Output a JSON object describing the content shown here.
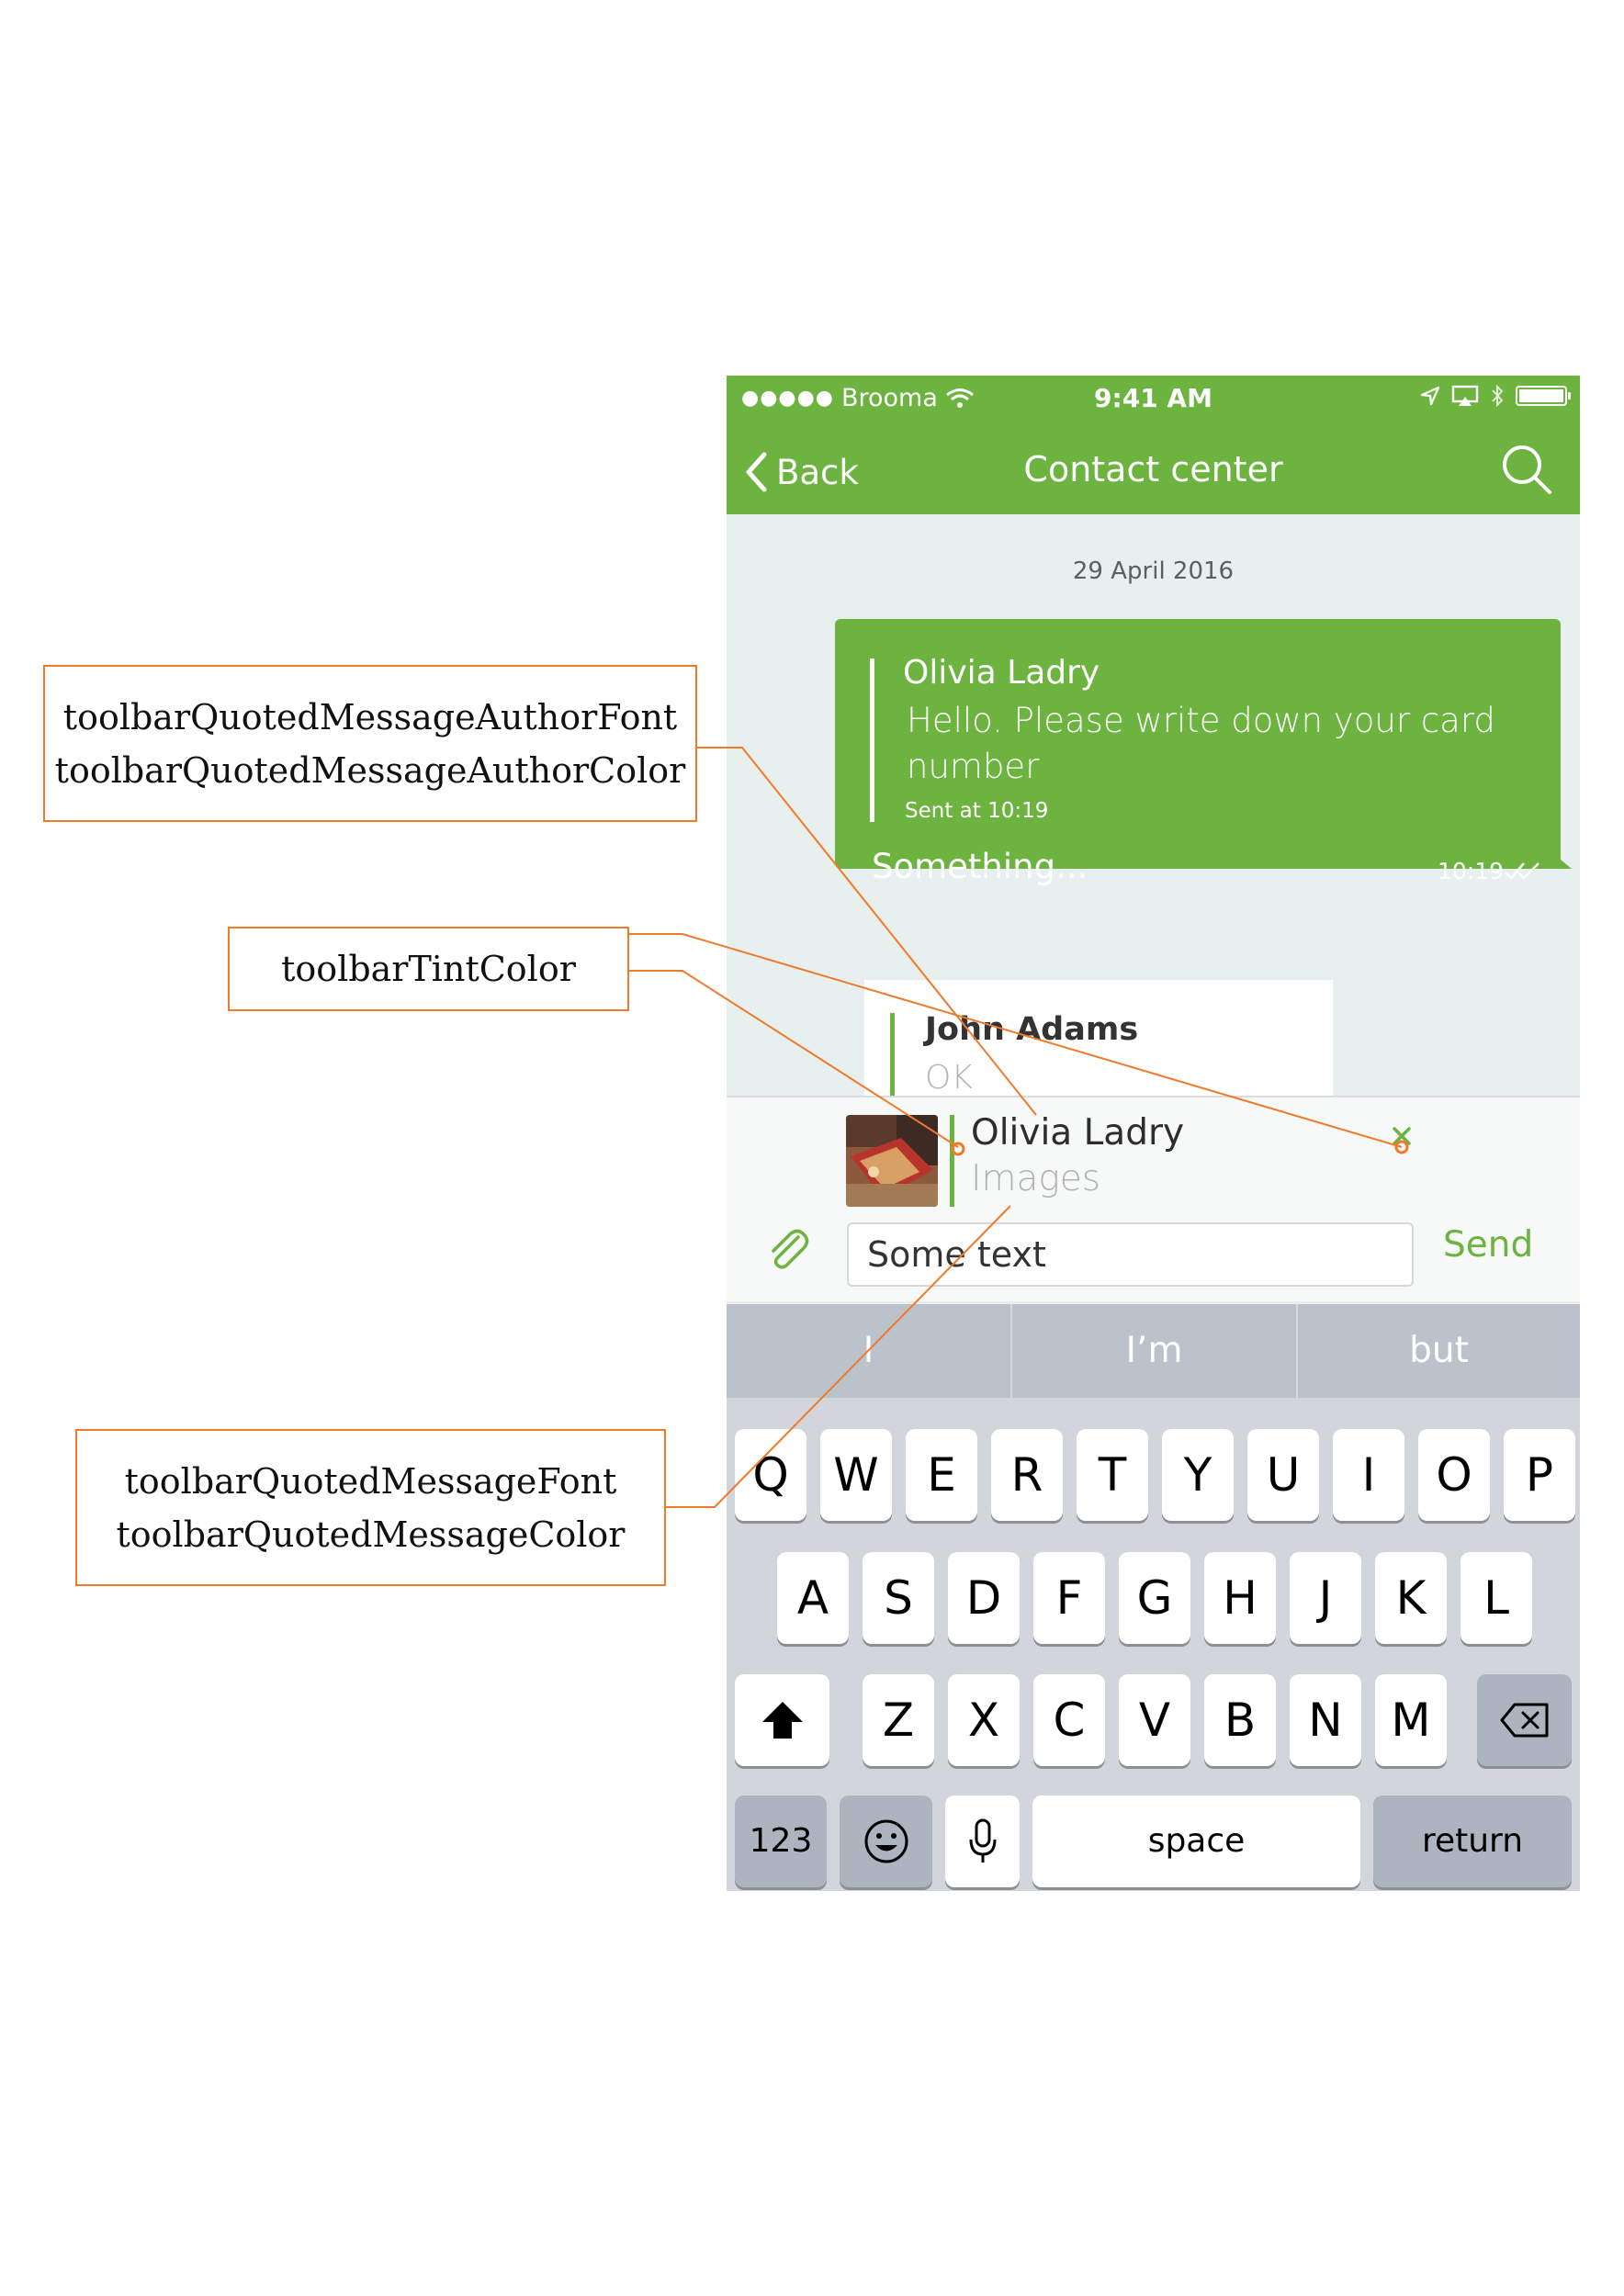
{
  "annotations": {
    "author": {
      "line1": "toolbarQuotedMessageAuthorFont",
      "line2": "toolbarQuotedMessageAuthorColor"
    },
    "tint": {
      "line1": "toolbarTintColor"
    },
    "message": {
      "line1": "toolbarQuotedMessageFont",
      "line2": "toolbarQuotedMessageColor"
    },
    "accent_color": "#f07a2a"
  },
  "status_bar": {
    "carrier_dots": "●●●●●",
    "carrier": "Brooma",
    "time": "9:41 AM",
    "icons": [
      "wifi-icon",
      "location-icon",
      "airplay-icon",
      "bluetooth-icon",
      "battery-icon"
    ]
  },
  "nav": {
    "back_label": "Back",
    "title": "Contact center",
    "search_icon": "search-icon",
    "bar_color": "#6db33f"
  },
  "chat": {
    "date": "29 April 2016",
    "outgoing": {
      "quoted_author": "Olivia Ladry",
      "quoted_text": "Hello. Please write down your card number",
      "quoted_sent": "Sent at 10:19",
      "text": "Something...",
      "time": "10:19",
      "status_icon": "double-check-icon"
    },
    "incoming": {
      "quoted_author": "John Adams",
      "quoted_text": "OK"
    }
  },
  "composer": {
    "quote_author": "Olivia Ladry",
    "quote_message": "Images",
    "input_value": "Some text",
    "send_label": "Send",
    "attach_icon": "paperclip-icon",
    "close_icon": "close-icon"
  },
  "keyboard": {
    "suggestions": [
      "I",
      "I’m",
      "but"
    ],
    "row1": [
      "Q",
      "W",
      "E",
      "R",
      "T",
      "Y",
      "U",
      "I",
      "O",
      "P"
    ],
    "row2": [
      "A",
      "S",
      "D",
      "F",
      "G",
      "H",
      "J",
      "K",
      "L"
    ],
    "row3": [
      "Z",
      "X",
      "C",
      "V",
      "B",
      "N",
      "M"
    ],
    "numbers_label": "123",
    "space_label": "space",
    "return_label": "return",
    "icons": [
      "shift-icon",
      "backspace-icon",
      "emoji-icon",
      "microphone-icon"
    ]
  }
}
